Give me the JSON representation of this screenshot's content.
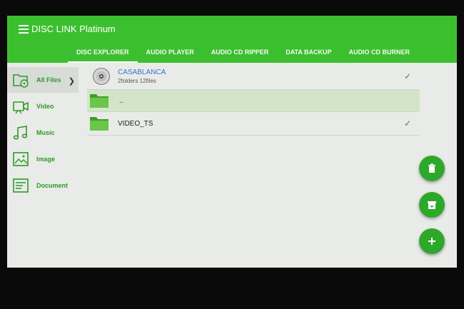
{
  "app": {
    "title": "DISC LINK Platinum"
  },
  "tabs": [
    {
      "label": "DISC EXPLORER"
    },
    {
      "label": "AUDIO PLAYER"
    },
    {
      "label": "AUDIO CD RIPPER"
    },
    {
      "label": "DATA BACKUP"
    },
    {
      "label": "AUDIO CD BURNER"
    }
  ],
  "sidebar": {
    "items": [
      {
        "label": "All Files",
        "icon": "folder-disc-icon"
      },
      {
        "label": "Video",
        "icon": "video-camera-icon"
      },
      {
        "label": "Music",
        "icon": "music-note-icon"
      },
      {
        "label": "Image",
        "icon": "image-icon"
      },
      {
        "label": "Document",
        "icon": "document-icon"
      }
    ]
  },
  "files": [
    {
      "name": "CASABLANCA",
      "sub": "2folders 12files",
      "icon": "disc-icon",
      "checked": true
    },
    {
      "name": "..",
      "sub": "",
      "icon": "folder-icon",
      "checked": false
    },
    {
      "name": "VIDEO_TS",
      "sub": "",
      "icon": "folder-icon",
      "checked": true
    }
  ],
  "fabs": [
    {
      "icon": "delete-icon"
    },
    {
      "icon": "archive-icon"
    },
    {
      "icon": "add-icon"
    }
  ],
  "colors": {
    "appbar": "#3cbf2f",
    "accent": "#2e9b26",
    "link": "#3a6fd0",
    "fab": "#2ea82a"
  }
}
